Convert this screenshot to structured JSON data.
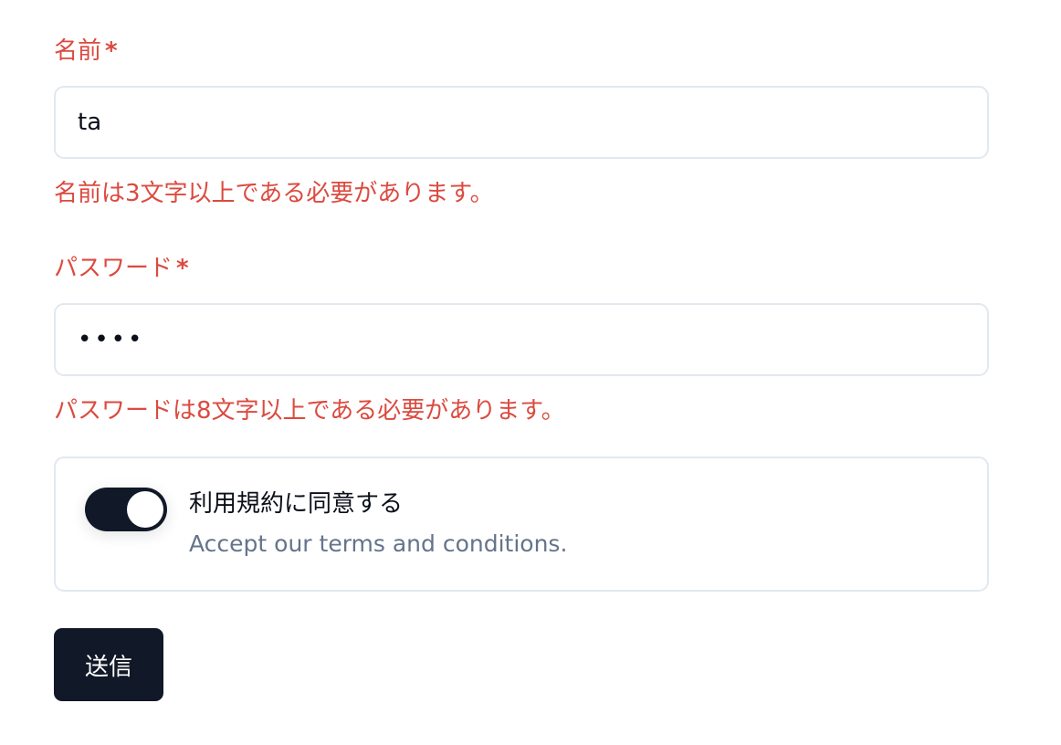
{
  "form": {
    "name_field": {
      "label": "名前",
      "required_mark": "*",
      "value": "ta",
      "error": "名前は3文字以上である必要があります。"
    },
    "password_field": {
      "label": "パスワード",
      "required_mark": "*",
      "value": "••••",
      "error": "パスワードは8文字以上である必要があります。"
    },
    "terms": {
      "title": "利用規約に同意する",
      "description": "Accept our terms and conditions.",
      "checked": true
    },
    "submit_label": "送信"
  },
  "colors": {
    "error": "#dc4a3f",
    "primary": "#111827",
    "border": "#e2e8f0",
    "muted": "#64748b"
  }
}
